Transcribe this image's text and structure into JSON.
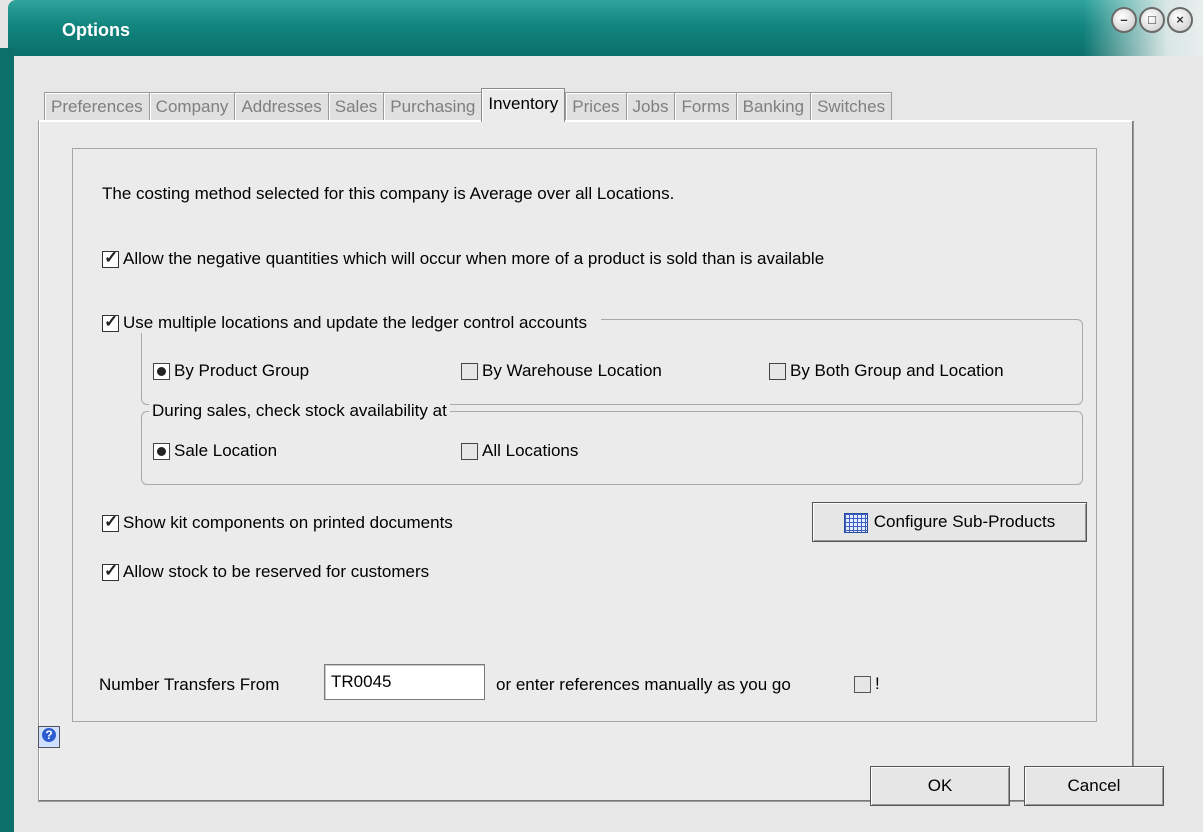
{
  "window": {
    "title": "Options"
  },
  "tabs": [
    {
      "label": "Preferences"
    },
    {
      "label": "Company"
    },
    {
      "label": "Addresses"
    },
    {
      "label": "Sales"
    },
    {
      "label": "Purchasing"
    },
    {
      "label": "Inventory",
      "active": true
    },
    {
      "label": "Prices"
    },
    {
      "label": "Jobs"
    },
    {
      "label": "Forms"
    },
    {
      "label": "Banking"
    },
    {
      "label": "Switches"
    }
  ],
  "inventory": {
    "costing_text": "The costing method selected for this company is Average over all Locations.",
    "allow_negative": {
      "label": "Allow the negative quantities which will occur when more of a product is sold than is available",
      "checked": true
    },
    "multi_locations": {
      "label": "Use multiple locations and update the ledger control accounts",
      "checked": true
    },
    "update_by": {
      "options": [
        {
          "label": "By Product Group",
          "selected": true
        },
        {
          "label": "By Warehouse Location",
          "selected": false
        },
        {
          "label": "By Both Group and Location",
          "selected": false
        }
      ]
    },
    "stock_check": {
      "label": "During sales, check stock availability at",
      "options": [
        {
          "label": "Sale Location",
          "selected": true
        },
        {
          "label": "All Locations",
          "selected": false
        }
      ]
    },
    "show_kit": {
      "label": "Show kit components on printed documents",
      "checked": true
    },
    "configure_button": "Configure Sub-Products",
    "allow_reserve": {
      "label": "Allow stock to be reserved for customers",
      "checked": true
    },
    "number_transfers_label": "Number Transfers From",
    "number_transfers_value": "TR0045",
    "manual_refs_label": "or enter references manually as you go",
    "manual_refs_checked": false,
    "manual_refs_suffix": "!"
  },
  "footer": {
    "ok_label": "OK",
    "cancel_label": "Cancel"
  },
  "icons": {
    "help": "help-icon",
    "configure": "grid-icon",
    "minimize": "minimize-icon",
    "maximize": "maximize-icon",
    "close": "close-icon"
  },
  "colors": {
    "titlebar": "#12857f",
    "title_text": "#ffffff",
    "panel": "#ebebeb"
  }
}
